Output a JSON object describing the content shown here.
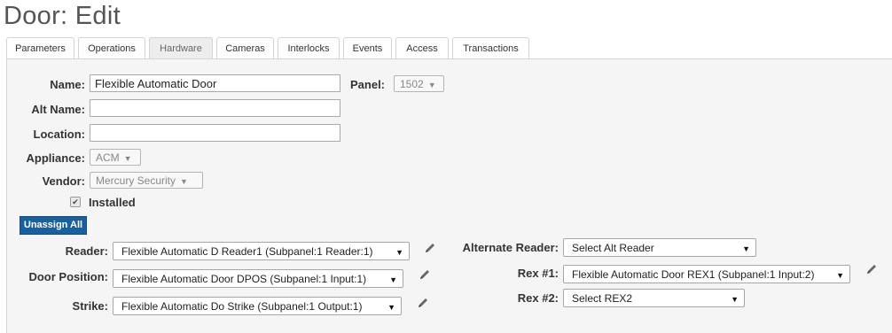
{
  "page_title": "Door: Edit",
  "tabs": [
    {
      "label": "Parameters"
    },
    {
      "label": "Operations"
    },
    {
      "label": "Hardware"
    },
    {
      "label": "Cameras"
    },
    {
      "label": "Interlocks"
    },
    {
      "label": "Events"
    },
    {
      "label": "Access"
    },
    {
      "label": "Transactions"
    }
  ],
  "active_tab": "Hardware",
  "form": {
    "name_label": "Name:",
    "name_value": "Flexible Automatic Door",
    "panel_label": "Panel:",
    "panel_value": "1502",
    "alt_name_label": "Alt Name:",
    "alt_name_value": "",
    "location_label": "Location:",
    "location_value": "",
    "appliance_label": "Appliance:",
    "appliance_value": "ACM",
    "vendor_label": "Vendor:",
    "vendor_value": "Mercury Security",
    "installed_label": "Installed",
    "installed_checked": true,
    "unassign_all_label": "Unassign All"
  },
  "hardware": {
    "reader_label": "Reader:",
    "reader_value": "Flexible Automatic D Reader1 (Subpanel:1 Reader:1)",
    "door_position_label": "Door Position:",
    "door_position_value": "Flexible Automatic Door DPOS (Subpanel:1 Input:1)",
    "strike_label": "Strike:",
    "strike_value": "Flexible Automatic Do Strike (Subpanel:1 Output:1)",
    "alt_reader_label": "Alternate Reader:",
    "alt_reader_value": "Select Alt Reader",
    "rex1_label": "Rex #1:",
    "rex1_value": "Flexible Automatic Door REX1 (Subpanel:1 Input:2)",
    "rex2_label": "Rex #2:",
    "rex2_value": "Select REX2"
  },
  "icons": {
    "edit": "pencil-icon",
    "dropdown": "chevron-down-icon",
    "checkbox": "check-icon"
  },
  "colors": {
    "accent": "#1a5f9e",
    "panel_bg": "#f5f5f5"
  }
}
